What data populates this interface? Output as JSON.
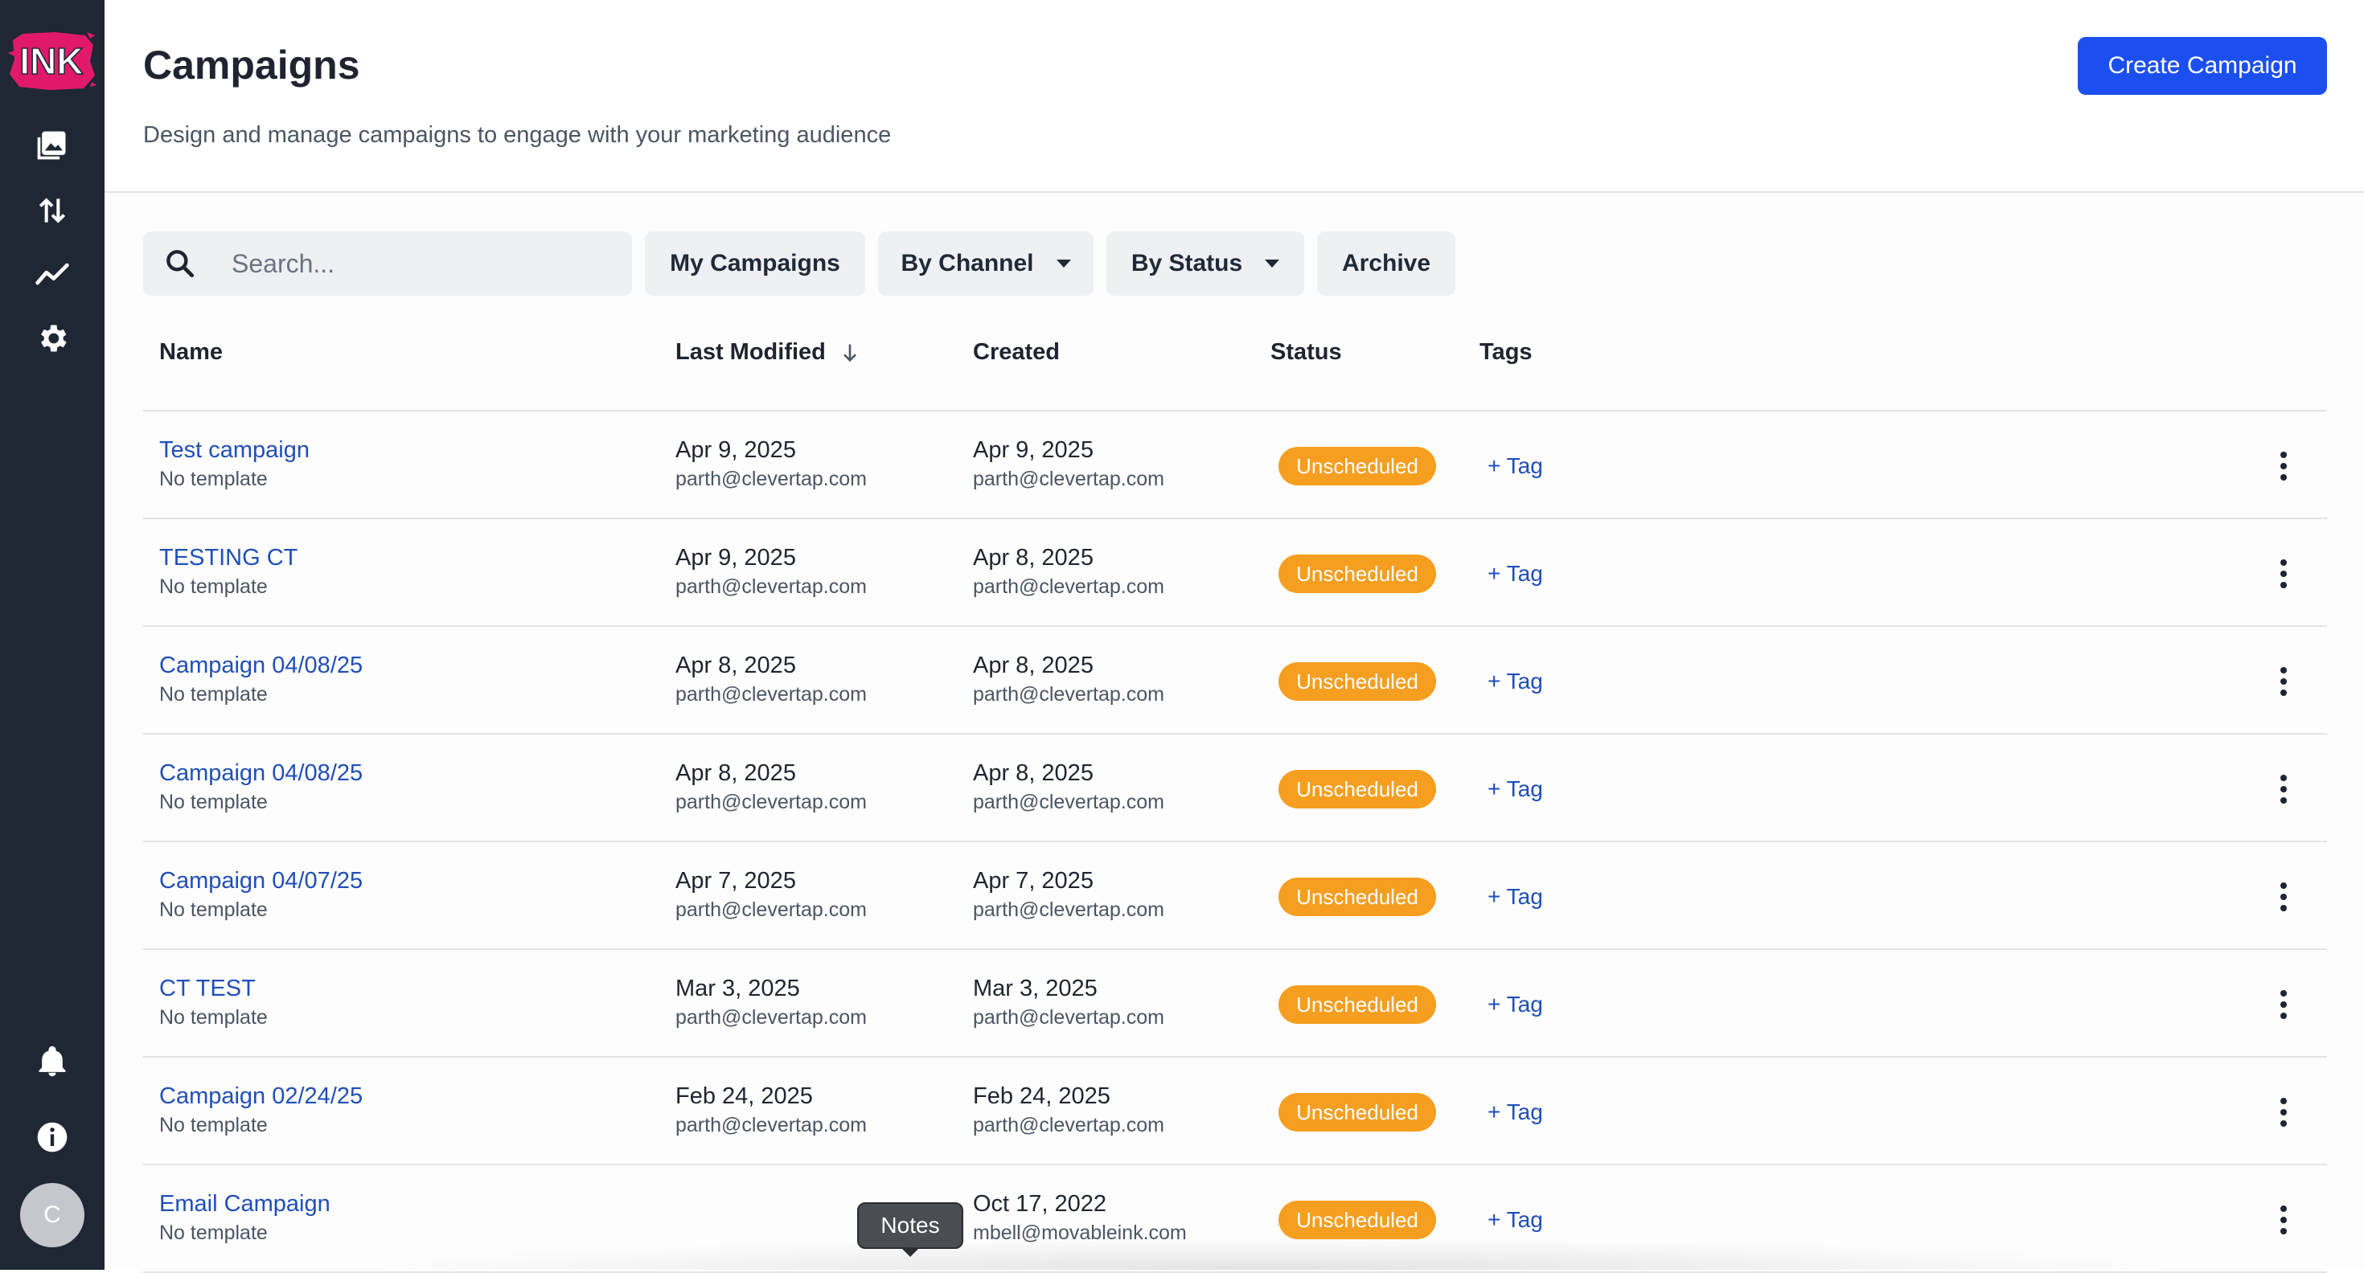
{
  "app": {
    "logo_text": "INK",
    "avatar_initial": "C",
    "colors": {
      "sidebar": "#1e2733",
      "accent": "#1b4ff0",
      "badge": "#f59e1f",
      "link": "#1f4fb8"
    }
  },
  "sidebar": {
    "top_icons": [
      "gallery-icon",
      "sort-arrows-icon",
      "analytics-icon",
      "gear-icon"
    ],
    "bottom_icons": [
      "bell-icon",
      "info-icon"
    ]
  },
  "header": {
    "title": "Campaigns",
    "subtitle": "Design and manage campaigns to engage with your marketing audience",
    "create_label": "Create Campaign"
  },
  "toolbar": {
    "search_placeholder": "Search...",
    "my_campaigns": "My Campaigns",
    "by_channel": "By Channel",
    "by_status": "By Status",
    "archive": "Archive"
  },
  "table": {
    "headers": {
      "name": "Name",
      "last_modified": "Last Modified",
      "created": "Created",
      "status": "Status",
      "tags": "Tags"
    },
    "rows": [
      {
        "name": "Test campaign",
        "template": "No template",
        "modified_date": "Apr 9, 2025",
        "modified_by": "parth@clevertap.com",
        "created_date": "Apr 9, 2025",
        "created_by": "parth@clevertap.com",
        "status": "Unscheduled",
        "tag": "+ Tag"
      },
      {
        "name": "TESTING CT",
        "template": "No template",
        "modified_date": "Apr 9, 2025",
        "modified_by": "parth@clevertap.com",
        "created_date": "Apr 8, 2025",
        "created_by": "parth@clevertap.com",
        "status": "Unscheduled",
        "tag": "+ Tag"
      },
      {
        "name": "Campaign 04/08/25",
        "template": "No template",
        "modified_date": "Apr 8, 2025",
        "modified_by": "parth@clevertap.com",
        "created_date": "Apr 8, 2025",
        "created_by": "parth@clevertap.com",
        "status": "Unscheduled",
        "tag": "+ Tag"
      },
      {
        "name": "Campaign 04/08/25",
        "template": "No template",
        "modified_date": "Apr 8, 2025",
        "modified_by": "parth@clevertap.com",
        "created_date": "Apr 8, 2025",
        "created_by": "parth@clevertap.com",
        "status": "Unscheduled",
        "tag": "+ Tag"
      },
      {
        "name": "Campaign 04/07/25",
        "template": "No template",
        "modified_date": "Apr 7, 2025",
        "modified_by": "parth@clevertap.com",
        "created_date": "Apr 7, 2025",
        "created_by": "parth@clevertap.com",
        "status": "Unscheduled",
        "tag": "+ Tag"
      },
      {
        "name": "CT TEST",
        "template": "No template",
        "modified_date": "Mar 3, 2025",
        "modified_by": "parth@clevertap.com",
        "created_date": "Mar 3, 2025",
        "created_by": "parth@clevertap.com",
        "status": "Unscheduled",
        "tag": "+ Tag"
      },
      {
        "name": "Campaign 02/24/25",
        "template": "No template",
        "modified_date": "Feb 24, 2025",
        "modified_by": "parth@clevertap.com",
        "created_date": "Feb 24, 2025",
        "created_by": "parth@clevertap.com",
        "status": "Unscheduled",
        "tag": "+ Tag"
      },
      {
        "name": "Email Campaign",
        "template": "No template",
        "modified_date": "",
        "modified_by": "",
        "created_date": "Oct 17, 2022",
        "created_by": "mbell@movableink.com",
        "status": "Unscheduled",
        "tag": "+ Tag"
      }
    ]
  },
  "tooltip": {
    "label": "Notes"
  }
}
